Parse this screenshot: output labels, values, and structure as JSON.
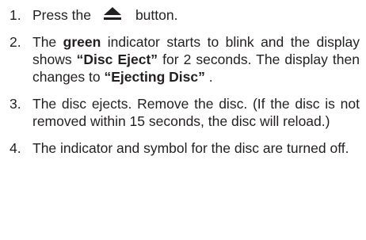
{
  "steps": [
    {
      "number": "1.",
      "before": "Press the",
      "icon": "eject-icon",
      "after": "button."
    },
    {
      "number": "2.",
      "t1": "The ",
      "b1": "green",
      "t2": " indicator starts to blink and the display shows ",
      "b2": "“Disc Eject”",
      "t3": " for 2 seconds. The display then changes to ",
      "b3": "“Ejecting Disc”",
      "t4": " ."
    },
    {
      "number": "3.",
      "text": "The disc ejects. Remove the disc. (If the disc is not removed within 15 seconds, the disc will reload.)"
    },
    {
      "number": "4.",
      "text": "The indicator and symbol for the disc are turned off."
    }
  ]
}
